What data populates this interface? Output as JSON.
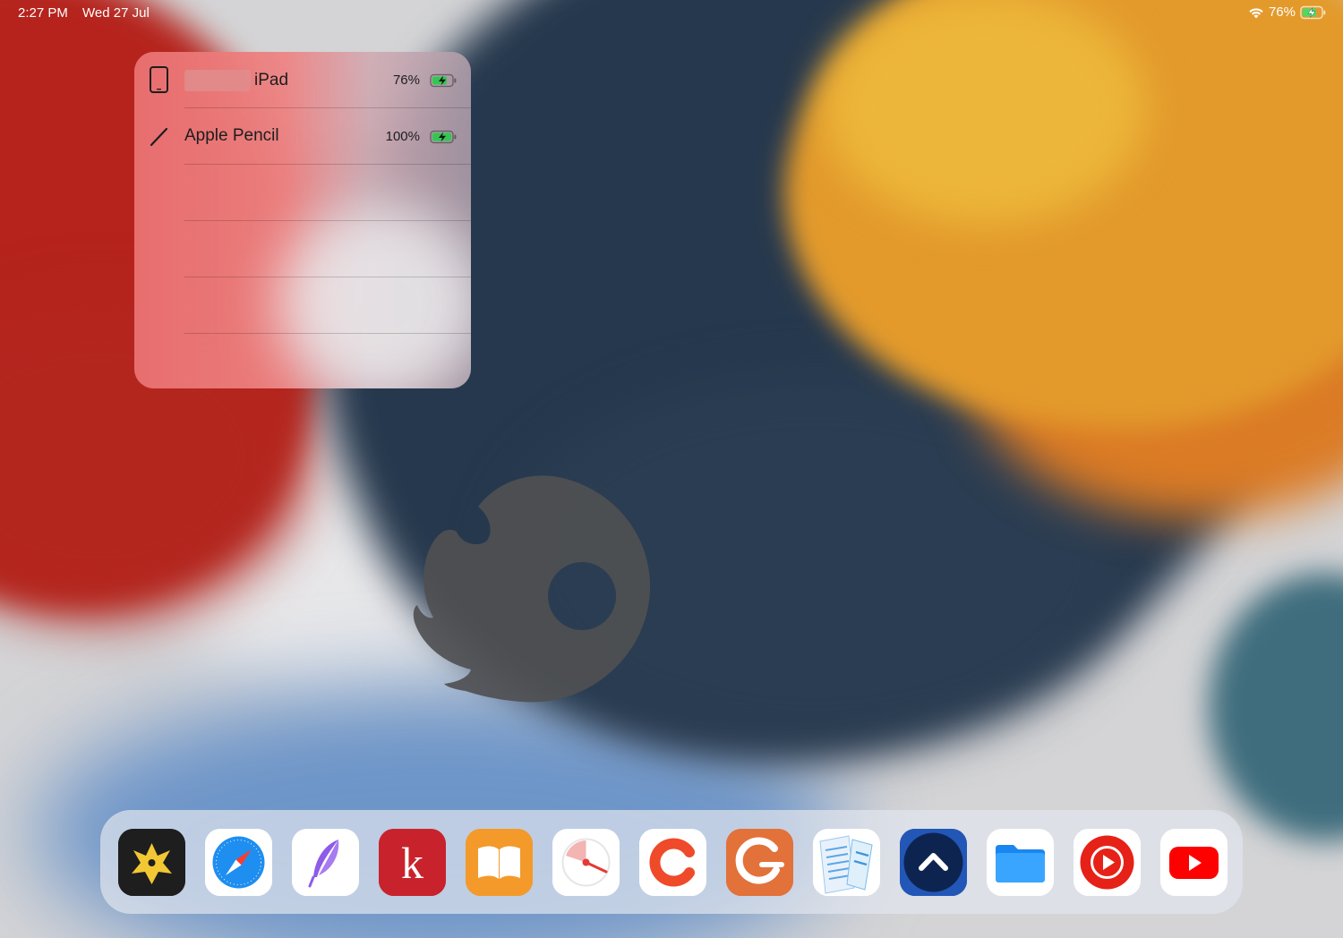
{
  "status_bar": {
    "time": "2:27 PM",
    "date": "Wed 27 Jul",
    "battery_percent": "76%",
    "icons": [
      "wifi-icon",
      "battery-charging-icon"
    ]
  },
  "batteries_widget": {
    "devices": [
      {
        "name": "iPad",
        "percent": "76%",
        "level": 0.76,
        "charging": true,
        "icon": "ipad-icon"
      },
      {
        "name": "Apple Pencil",
        "percent": "100%",
        "level": 1.0,
        "charging": true,
        "icon": "pencil-icon"
      }
    ],
    "accent_color": "#32c751"
  },
  "loading_indicator": {
    "icon": "loading-spinner-icon"
  },
  "dock": {
    "apps": [
      {
        "icon": "ulysses-icon",
        "color": "#1c1c1c"
      },
      {
        "icon": "safari-icon",
        "color": "#ffffff"
      },
      {
        "icon": "quill-icon",
        "color": "#ffffff"
      },
      {
        "icon": "k-icon",
        "color": "#c8232c"
      },
      {
        "icon": "books-icon",
        "color": "#f39a2a"
      },
      {
        "icon": "timer-icon",
        "color": "#ffffff"
      },
      {
        "icon": "c-icon",
        "color": "#ffffff"
      },
      {
        "icon": "g-icon",
        "color": "#e3713a"
      },
      {
        "icon": "notes-doc-icon",
        "color": "#ffffff"
      },
      {
        "icon": "chevron-up-icon",
        "color": "#1d3f8a"
      },
      {
        "icon": "files-icon",
        "color": "#ffffff"
      },
      {
        "icon": "youtube-music-icon",
        "color": "#ffffff"
      },
      {
        "icon": "youtube-icon",
        "color": "#ffffff"
      }
    ]
  }
}
